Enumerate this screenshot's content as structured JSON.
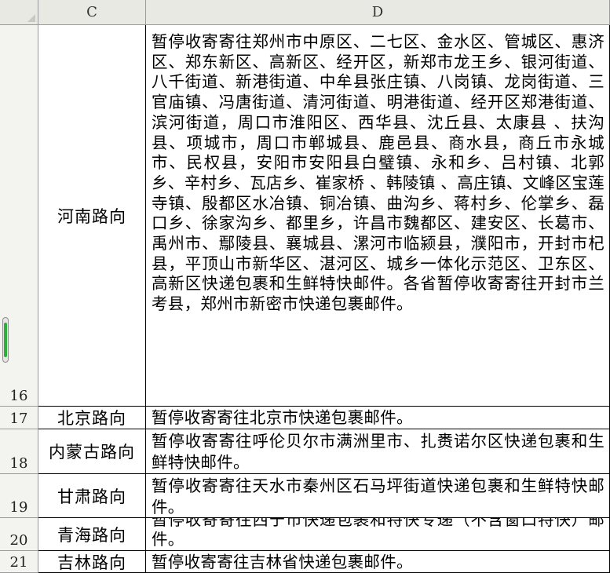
{
  "columns": {
    "c": "C",
    "d": "D"
  },
  "rows": [
    {
      "num": "16",
      "route": "河南路向",
      "note": "暂停收寄寄往郑州市中原区、二七区、金水区、管城区、惠济区、郑东新区、高新区、经开区，新郑市龙王乡、银河街道、八千街道、新港街道、中牟县张庄镇、八岗镇、龙岗街道、三官庙镇、冯唐街道、清河街道、明港街道、经开区郑港街道、滨河街道，周口市淮阳区、西华县、沈丘县、太康县 、扶沟县、项城市，周口市郸城县、鹿邑县、商水县，商丘市永城市、民权县，安阳市安阳县白璧镇、永和乡、吕村镇、北郭乡、辛村乡、瓦店乡、崔家桥 、韩陵镇 、高庄镇、文峰区宝莲寺镇、殷都区水冶镇、铜冶镇、曲沟乡、蒋村乡、伦掌乡、磊口乡、徐家沟乡、都里乡，许昌市魏都区、建安区、长葛市、禹州市、鄢陵县、襄城县、漯河市临颍县，濮阳市，开封市杞县，平顶山市新华区、湛河区、城乡一体化示范区、卫东区、高新区快递包裹和生鲜特快邮件。各省暂停收寄寄往开封市兰考县，郑州市新密市快递包裹邮件。"
    },
    {
      "num": "17",
      "route": "北京路向",
      "note": "暂停收寄寄往北京市快递包裹邮件。"
    },
    {
      "num": "18",
      "route": "内蒙古路向",
      "note": "暂停收寄寄往呼伦贝尔市满洲里市、扎赉诺尔区快递包裹和生鲜特快邮件。"
    },
    {
      "num": "19",
      "route": "甘肃路向",
      "note": "暂停收寄寄往天水市秦州区石马坪街道快递包裹和生鲜特快邮件。"
    },
    {
      "num": "20",
      "route": "青海路向",
      "note": "暂停收寄寄往西宁市快递包裹和特快专递（不含窗口特快）邮件。"
    },
    {
      "num": "21",
      "route": "吉林路向",
      "note": "暂停收寄寄往吉林省快递包裹邮件。"
    }
  ]
}
